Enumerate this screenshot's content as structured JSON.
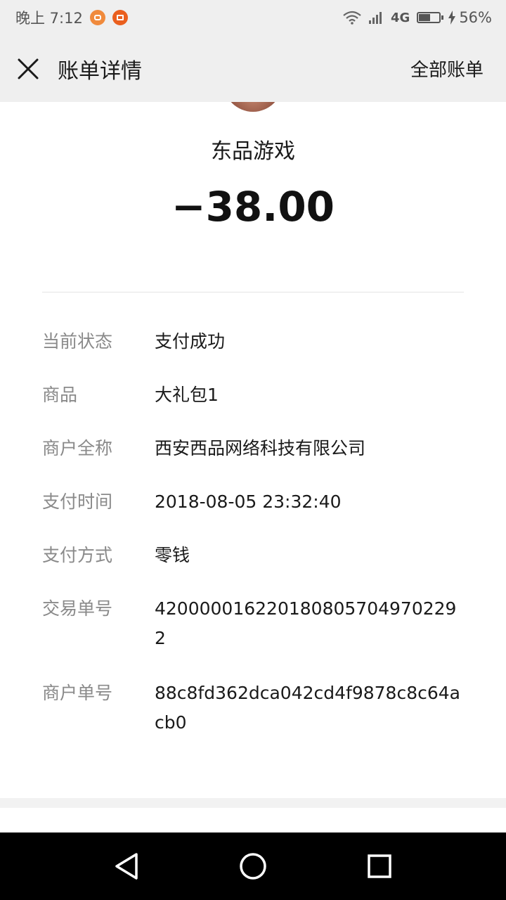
{
  "status_bar": {
    "time": "晚上 7:12",
    "network": "4G",
    "battery": "56%",
    "battery_level": 0.56
  },
  "header": {
    "title": "账单详情",
    "all_bills_link": "全部账单",
    "close_icon": "close-icon"
  },
  "merchant": {
    "name": "东品游戏",
    "amount": "−38.00"
  },
  "details": [
    {
      "label": "当前状态",
      "value": "支付成功"
    },
    {
      "label": "商品",
      "value": "大礼包1"
    },
    {
      "label": "商户全称",
      "value": "西安西品网络科技有限公司"
    },
    {
      "label": "支付时间",
      "value": "2018-08-05 23:32:40"
    },
    {
      "label": "支付方式",
      "value": "零钱"
    },
    {
      "label": "交易单号",
      "value": "4200000162201808057049702292"
    },
    {
      "label": "商户单号",
      "value": "88c8fd362dca042cd4f9878c8c64acb0"
    }
  ],
  "nav": {
    "back_icon": "back-triangle-icon",
    "home_icon": "home-circle-icon",
    "recents_icon": "recents-square-icon"
  }
}
